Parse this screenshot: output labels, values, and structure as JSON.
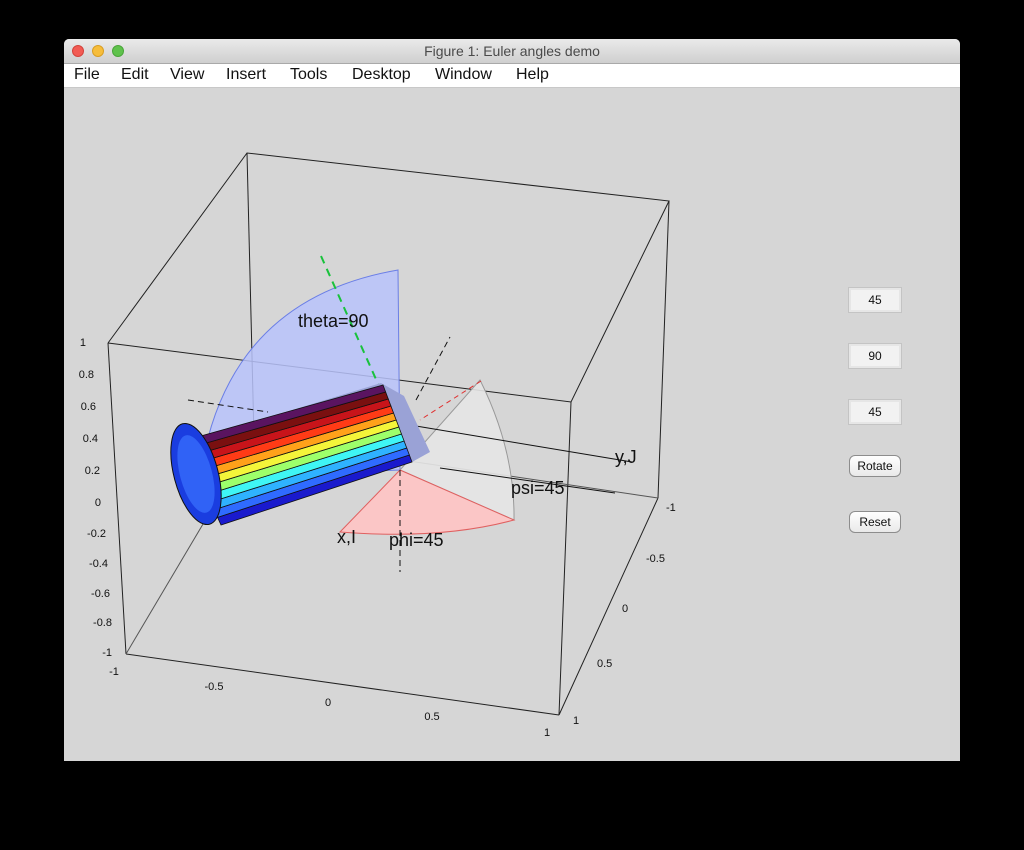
{
  "window": {
    "title": "Figure 1: Euler angles demo"
  },
  "menu": [
    "File",
    "Edit",
    "View",
    "Insert",
    "Tools",
    "Desktop",
    "Window",
    "Help"
  ],
  "plot": {
    "labels": {
      "theta": "theta=90",
      "phi": "phi=45",
      "psi": "psi=45",
      "x_axis": "x,I",
      "y_axis": "y,J"
    },
    "z_ticks": [
      "1",
      "0.8",
      "0.6",
      "0.4",
      "0.2",
      "0",
      "-0.2",
      "-0.4",
      "-0.6",
      "-0.8",
      "-1"
    ],
    "x_ticks": [
      "-1",
      "-0.5",
      "0",
      "0.5",
      "1"
    ],
    "y_ticks": [
      "-1",
      "-0.5",
      "0",
      "0.5",
      "1"
    ]
  },
  "controls": {
    "phi_value": "45",
    "theta_value": "90",
    "psi_value": "45",
    "rotate_label": "Rotate",
    "reset_label": "Reset"
  },
  "colors": {
    "cylinder_bands": [
      "#1a1acd",
      "#2f6bff",
      "#2fb2ff",
      "#3ff5f5",
      "#9dff6b",
      "#f4f53a",
      "#ffa11a",
      "#ff3b16",
      "#c8141a",
      "#7a1010",
      "#5a1460"
    ]
  }
}
